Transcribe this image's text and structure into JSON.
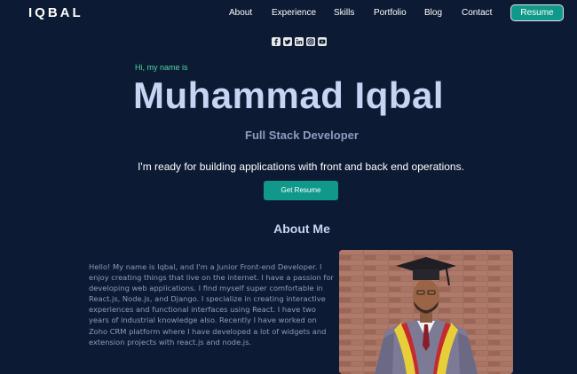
{
  "nav": {
    "logo": "IQBAL",
    "links": [
      "About",
      "Experience",
      "Skills",
      "Portfolio",
      "Blog",
      "Contact"
    ],
    "resume_label": "Resume"
  },
  "socials": [
    "facebook-icon",
    "twitter-icon",
    "linkedin-icon",
    "instagram-icon",
    "youtube-icon"
  ],
  "hero": {
    "greeting": "Hi, my name is",
    "name": "Muhammad Iqbal",
    "role": "Full Stack Developer",
    "tagline": "I'm ready for building applications with front and back end operations.",
    "button_label": "Get Resume"
  },
  "about": {
    "title": "About Me",
    "text": "Hello! My name is Iqbal, and I'm a Junior Front-end Developer. I enjoy creating things that live on the internet. I have a passion for developing web applications. I find myself super comfortable in React.js, Node.js, and Django. I specialize in creating interactive experiences and functional interfaces using React. I have two years of industrial knowledge also. Recently I have worked on Zoho CRM platform where I have developed a lot of widgets and extension projects with react.js and node.js."
  },
  "colors": {
    "background": "#0c1a33",
    "accent": "#10998a",
    "greeting": "#51d9a6",
    "heading": "#c9d4f4",
    "muted": "#8f9bbd"
  }
}
